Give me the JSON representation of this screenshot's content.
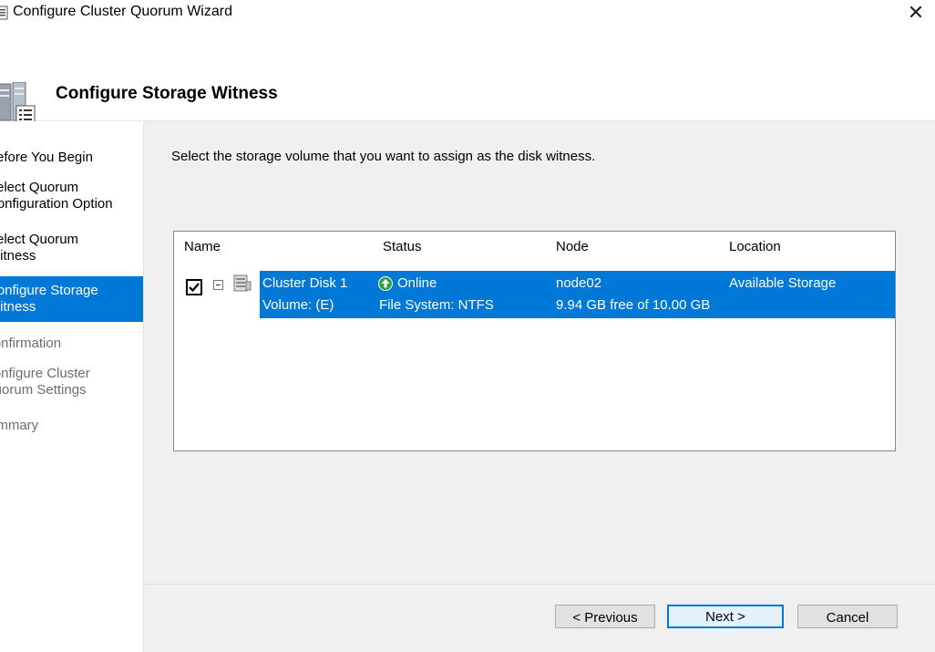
{
  "window": {
    "title": "Configure Cluster Quorum Wizard",
    "close_glyph": "✕"
  },
  "header": {
    "title": "Configure Storage Witness",
    "icon": "cluster-wizard-icon"
  },
  "steps": [
    {
      "label": "Before You Begin",
      "state": "done"
    },
    {
      "label": "Select Quorum Configuration Option",
      "state": "done"
    },
    {
      "label": "Select Quorum Witness",
      "state": "done"
    },
    {
      "label": "Configure Storage Witness",
      "state": "active"
    },
    {
      "label": "Confirmation",
      "state": "future"
    },
    {
      "label": "Configure Cluster Quorum Settings",
      "state": "future"
    },
    {
      "label": "Summary",
      "state": "future"
    }
  ],
  "main": {
    "instruction": "Select the storage volume that you want to assign as the disk witness."
  },
  "table": {
    "columns": [
      "Name",
      "Status",
      "Node",
      "Location"
    ],
    "row": {
      "checked": true,
      "name": "Cluster Disk 1",
      "status": "Online",
      "node": "node02",
      "location": "Available Storage",
      "volume": "Volume: (E)",
      "filesystem": "File System: NTFS",
      "free_space": "9.94 GB free of 10.00 GB"
    }
  },
  "buttons": {
    "previous": "< Previous",
    "next": "Next >",
    "cancel": "Cancel"
  },
  "colors": {
    "selection": "#0078d7",
    "online_green": "#2ea043"
  }
}
